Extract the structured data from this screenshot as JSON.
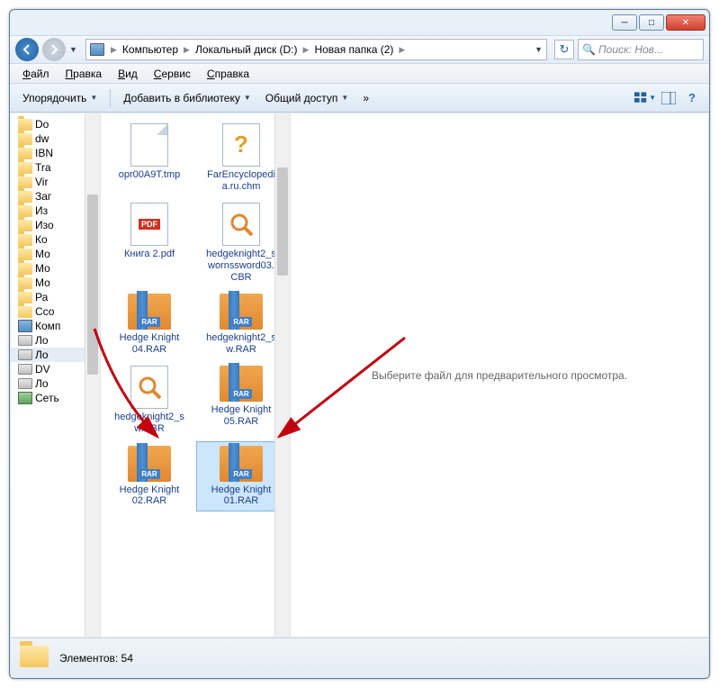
{
  "breadcrumb": {
    "root": "Компьютер",
    "drive": "Локальный диск (D:)",
    "folder": "Новая папка (2)"
  },
  "search": {
    "placeholder": "Поиск: Нов..."
  },
  "menu": {
    "file": "Файл",
    "edit": "Правка",
    "view": "Вид",
    "tools": "Сервис",
    "help": "Справка"
  },
  "toolbar": {
    "organize": "Упорядочить",
    "add_library": "Добавить в библиотеку",
    "share": "Общий доступ",
    "more": "»"
  },
  "tree": [
    {
      "icon": "folder",
      "label": "Do"
    },
    {
      "icon": "folder",
      "label": "dw"
    },
    {
      "icon": "folder",
      "label": "IBN"
    },
    {
      "icon": "folder",
      "label": "Tra"
    },
    {
      "icon": "folder",
      "label": "Vir"
    },
    {
      "icon": "folder",
      "label": "Заг"
    },
    {
      "icon": "folder",
      "label": "Из"
    },
    {
      "icon": "folder",
      "label": "Изо"
    },
    {
      "icon": "folder",
      "label": "Ко"
    },
    {
      "icon": "folder",
      "label": "Мо"
    },
    {
      "icon": "folder",
      "label": "Мо"
    },
    {
      "icon": "folder",
      "label": "Мо"
    },
    {
      "icon": "folder",
      "label": "Ра"
    },
    {
      "icon": "folder",
      "label": "Ссо"
    },
    {
      "icon": "comp",
      "label": "Комп"
    },
    {
      "icon": "drive",
      "label": "Ло"
    },
    {
      "icon": "drive",
      "label": "Ло",
      "selected": true
    },
    {
      "icon": "drive",
      "label": "DV"
    },
    {
      "icon": "drive",
      "label": "Ло"
    },
    {
      "icon": "net",
      "label": "Сеть"
    }
  ],
  "files": [
    {
      "type": "generic",
      "name": "opr00A9T.tmp"
    },
    {
      "type": "help",
      "name": "FarEncyclopedia.ru.chm"
    },
    {
      "type": "pdf",
      "name": "Книга 2.pdf"
    },
    {
      "type": "cbr",
      "name": "hedgeknight2_swornssword03.CBR"
    },
    {
      "type": "rar",
      "name": "Hedge Knight 04.RAR"
    },
    {
      "type": "rar",
      "name": "hedgeknight2_sw.RAR"
    },
    {
      "type": "cbr",
      "name": "hedgeknight2_sw.CBR"
    },
    {
      "type": "rar",
      "name": "Hedge Knight 05.RAR"
    },
    {
      "type": "rar",
      "name": "Hedge Knight 02.RAR"
    },
    {
      "type": "rar",
      "name": "Hedge Knight 01.RAR",
      "selected": true
    }
  ],
  "preview_hint": "Выберите файл для предварительного просмотра.",
  "status": {
    "count_label": "Элементов: 54"
  }
}
